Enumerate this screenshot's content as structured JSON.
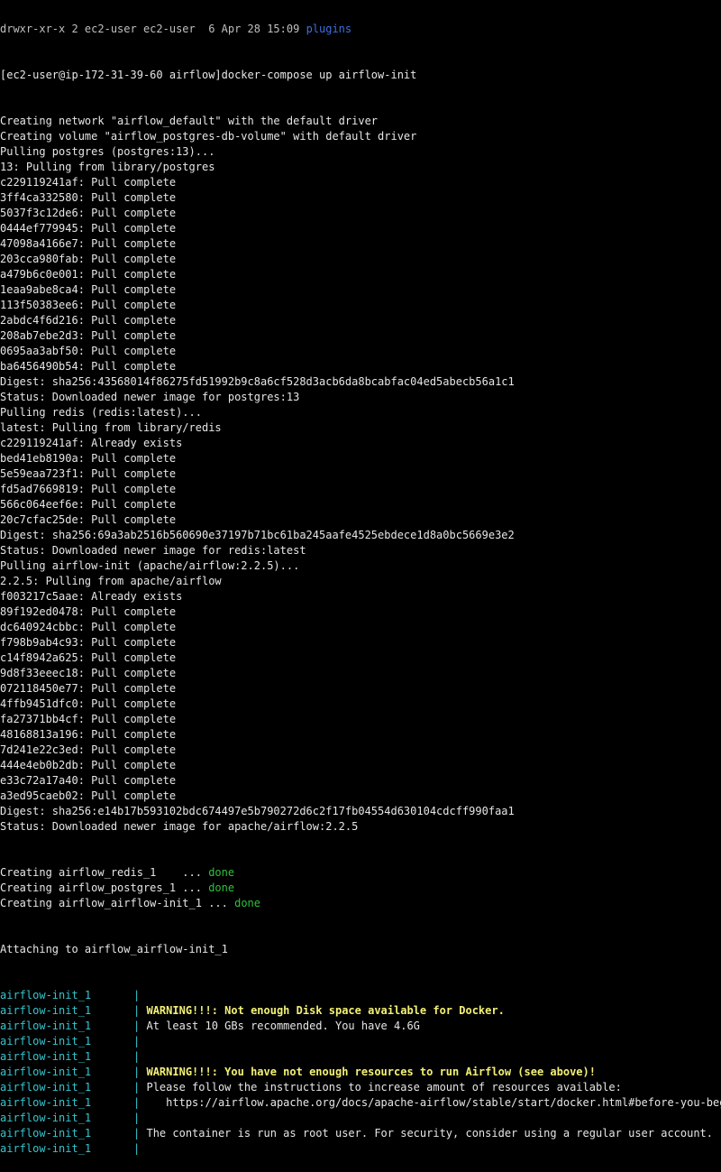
{
  "terminal": {
    "top_cut": {
      "text": "drwxr-xr-x 2 ec2-user ec2-user  6 Apr 28 15:09 ",
      "link": "plugins"
    },
    "prompt": "[ec2-user@ip-172-31-39-60 airflow]docker-compose up airflow-init",
    "setup_lines": [
      "Creating network \"airflow_default\" with the default driver",
      "Creating volume \"airflow_postgres-db-volume\" with default driver",
      "Pulling postgres (postgres:13)...",
      "13: Pulling from library/postgres",
      "c229119241af: Pull complete",
      "3ff4ca332580: Pull complete",
      "5037f3c12de6: Pull complete",
      "0444ef779945: Pull complete",
      "47098a4166e7: Pull complete",
      "203cca980fab: Pull complete",
      "a479b6c0e001: Pull complete",
      "1eaa9abe8ca4: Pull complete",
      "113f50383ee6: Pull complete",
      "2abdc4f6d216: Pull complete",
      "208ab7ebe2d3: Pull complete",
      "0695aa3abf50: Pull complete",
      "ba6456490b54: Pull complete",
      "Digest: sha256:43568014f86275fd51992b9c8a6cf528d3acb6da8bcabfac04ed5abecb56a1c1",
      "Status: Downloaded newer image for postgres:13",
      "Pulling redis (redis:latest)...",
      "latest: Pulling from library/redis",
      "c229119241af: Already exists",
      "bed41eb8190a: Pull complete",
      "5e59eaa723f1: Pull complete",
      "fd5ad7669819: Pull complete",
      "566c064eef6e: Pull complete",
      "20c7cfac25de: Pull complete",
      "Digest: sha256:69a3ab2516b560690e37197b71bc61ba245aafe4525ebdece1d8a0bc5669e3e2",
      "Status: Downloaded newer image for redis:latest",
      "Pulling airflow-init (apache/airflow:2.2.5)...",
      "2.2.5: Pulling from apache/airflow",
      "f003217c5aae: Already exists",
      "89f192ed0478: Pull complete",
      "dc640924cbbc: Pull complete",
      "f798b9ab4c93: Pull complete",
      "c14f8942a625: Pull complete",
      "9d8f33eeec18: Pull complete",
      "072118450e77: Pull complete",
      "4ffb9451dfc0: Pull complete",
      "fa27371bb4cf: Pull complete",
      "48168813a196: Pull complete",
      "7d241e22c3ed: Pull complete",
      "444e4eb0b2db: Pull complete",
      "e33c72a17a40: Pull complete",
      "a3ed95caeb02: Pull complete",
      "Digest: sha256:e14b17b593102bdc674497e5b790272d6c2f17fb04554d630104cdcff990faa1",
      "Status: Downloaded newer image for apache/airflow:2.2.5"
    ],
    "creating": [
      {
        "prefix": "Creating airflow_redis_1    ... ",
        "status": "done"
      },
      {
        "prefix": "Creating airflow_postgres_1 ... ",
        "status": "done"
      },
      {
        "prefix": "Creating airflow_airflow-init_1 ... ",
        "status": "done"
      }
    ],
    "attaching": "Attaching to airflow_airflow-init_1",
    "service_name": "airflow-init_1",
    "pipe": "|",
    "log_lines": [
      {
        "text": "",
        "style": "normal"
      },
      {
        "text": "WARNING!!!: Not enough Disk space available for Docker.",
        "style": "warn"
      },
      {
        "text": "At least 10 GBs recommended. You have 4.6G",
        "style": "normal"
      },
      {
        "text": "",
        "style": "normal"
      },
      {
        "text": "",
        "style": "normal"
      },
      {
        "text": "WARNING!!!: You have not enough resources to run Airflow (see above)!",
        "style": "warn"
      },
      {
        "text": "Please follow the instructions to increase amount of resources available:",
        "style": "normal"
      },
      {
        "text": "   https://airflow.apache.org/docs/apache-airflow/stable/start/docker.html#before-you-begin",
        "style": "normal"
      },
      {
        "text": "",
        "style": "normal"
      },
      {
        "text": "The container is run as root user. For security, consider using a regular user account.",
        "style": "normal"
      },
      {
        "text": "",
        "style": "normal"
      }
    ]
  }
}
